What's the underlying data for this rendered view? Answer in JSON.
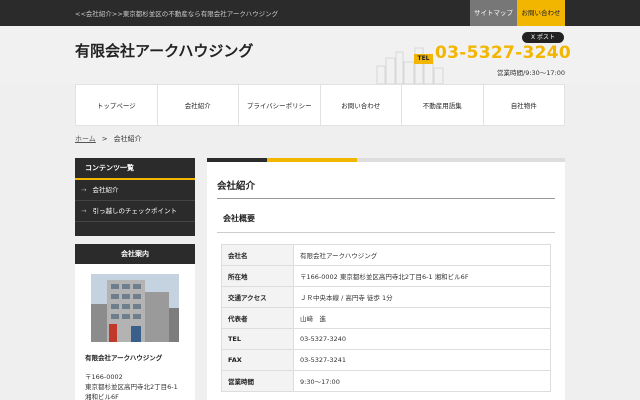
{
  "topbar": {
    "tagline": "<<会社紹介>>東京都杉並区の不動産なら有限会社アークハウジング",
    "sitemap": "サイトマップ",
    "contact": "お問い合わせ"
  },
  "header": {
    "logo": "有限会社アークハウジング",
    "x_post": "X ポスト",
    "tel_badge": "TEL",
    "tel": "03-5327-3240",
    "hours": "営業時間/9:30〜17:00"
  },
  "nav": [
    "トップページ",
    "会社紹介",
    "プライバシーポリシー",
    "お問い合わせ",
    "不動産用語集",
    "自社物件"
  ],
  "breadcrumb": {
    "home": "ホーム",
    "sep": ">",
    "current": "会社紹介"
  },
  "sidebar": {
    "contents_title": "コンテンツ一覧",
    "items": [
      "会社紹介",
      "引っ越しのチェックポイント"
    ],
    "info_title": "会社案内",
    "company": "有限会社アークハウジング",
    "postal": "〒166-0002",
    "address1": "東京都杉並区高円寺北2丁目6-1",
    "address2": "湘和ビル6F"
  },
  "main": {
    "title": "会社紹介",
    "section": "会社概要",
    "rows": [
      {
        "k": "会社名",
        "v": "有限会社アークハウジング"
      },
      {
        "k": "所在地",
        "v": "〒166-0002 東京都杉並区高円寺北2丁目6-1 湘和ビル6F"
      },
      {
        "k": "交通アクセス",
        "v": "ＪＲ中央本線 / 高円寺 徒歩 1分"
      },
      {
        "k": "代表者",
        "v": "山﨑　進"
      },
      {
        "k": "TEL",
        "v": "03-5327-3240"
      },
      {
        "k": "FAX",
        "v": "03-5327-3241"
      },
      {
        "k": "営業時間",
        "v": "9:30〜17:00"
      }
    ]
  },
  "colors": {
    "accent": "#f2b600",
    "dark": "#2b2b2b"
  }
}
